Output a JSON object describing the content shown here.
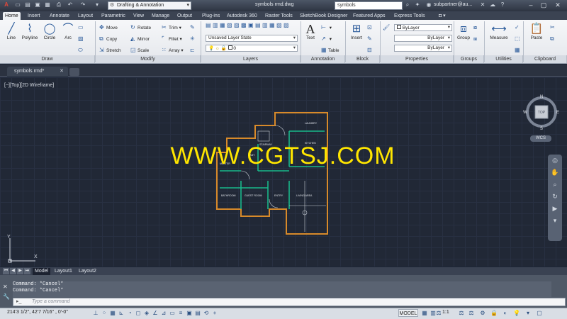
{
  "titlebar": {
    "workspace": "Drafting & Annotation",
    "document_title": "symbols rmd.dwg",
    "search_text": "symbols",
    "user": "subpartner@au..."
  },
  "ribbon_tabs": [
    "Home",
    "Insert",
    "Annotate",
    "Layout",
    "Parametric",
    "View",
    "Manage",
    "Output",
    "Plug-ins",
    "Autodesk 360",
    "Raster Tools",
    "SketchBook Designer",
    "Featured Apps",
    "Express Tools"
  ],
  "ribbon": {
    "draw": {
      "label": "Draw",
      "line": "Line",
      "polyline": "Polyline",
      "circle": "Circle",
      "arc": "Arc"
    },
    "modify": {
      "label": "Modify",
      "move": "Move",
      "rotate": "Rotate",
      "trim": "Trim",
      "copy": "Copy",
      "mirror": "Mirror",
      "fillet": "Fillet",
      "stretch": "Stretch",
      "scale": "Scale",
      "array": "Array"
    },
    "layers": {
      "label": "Layers",
      "layer_state": "Unsaved Layer State",
      "current_layer": "0"
    },
    "annotation": {
      "label": "Annotation",
      "text": "Text",
      "table": "Table"
    },
    "block": {
      "label": "Block",
      "insert": "Insert"
    },
    "properties": {
      "label": "Properties",
      "color": "ByLayer",
      "linetype": "ByLayer",
      "lineweight": "ByLayer"
    },
    "groups": {
      "label": "Groups",
      "group": "Group"
    },
    "utilities": {
      "label": "Utilities",
      "measure": "Measure"
    },
    "clipboard": {
      "label": "Clipboard",
      "paste": "Paste"
    }
  },
  "file_tab": "symbols rmd*",
  "viewport_label": "[−][Top][2D Wireframe]",
  "watermark": "WWW.CGTSJ.COM",
  "viewcube": {
    "face": "TOP",
    "n": "N",
    "s": "S",
    "e": "E",
    "w": "W",
    "wcs": "WCS"
  },
  "floorplan_rooms": [
    "LAUNDRY",
    "KITCHEN",
    "STAIRWAY",
    "BABY",
    "MASTER",
    "BATHROOM",
    "GUEST ROOM",
    "ENTRY",
    "LIVING AREA"
  ],
  "layout_tabs": [
    "Model",
    "Layout1",
    "Layout2"
  ],
  "command": {
    "history": [
      "Command: *Cancel*",
      "Command: *Cancel*"
    ],
    "placeholder": "Type a command"
  },
  "status": {
    "coords": "214'3 1/2\", 42'7 7/16\" , 0'-0\"",
    "model": "MODEL",
    "scale": "1:1"
  },
  "colors": {
    "accent": "#2a5a9a",
    "wall": "#d88a2a",
    "room_wall": "#18b88a",
    "watermark": "#ffe600",
    "canvas": "#212836"
  }
}
